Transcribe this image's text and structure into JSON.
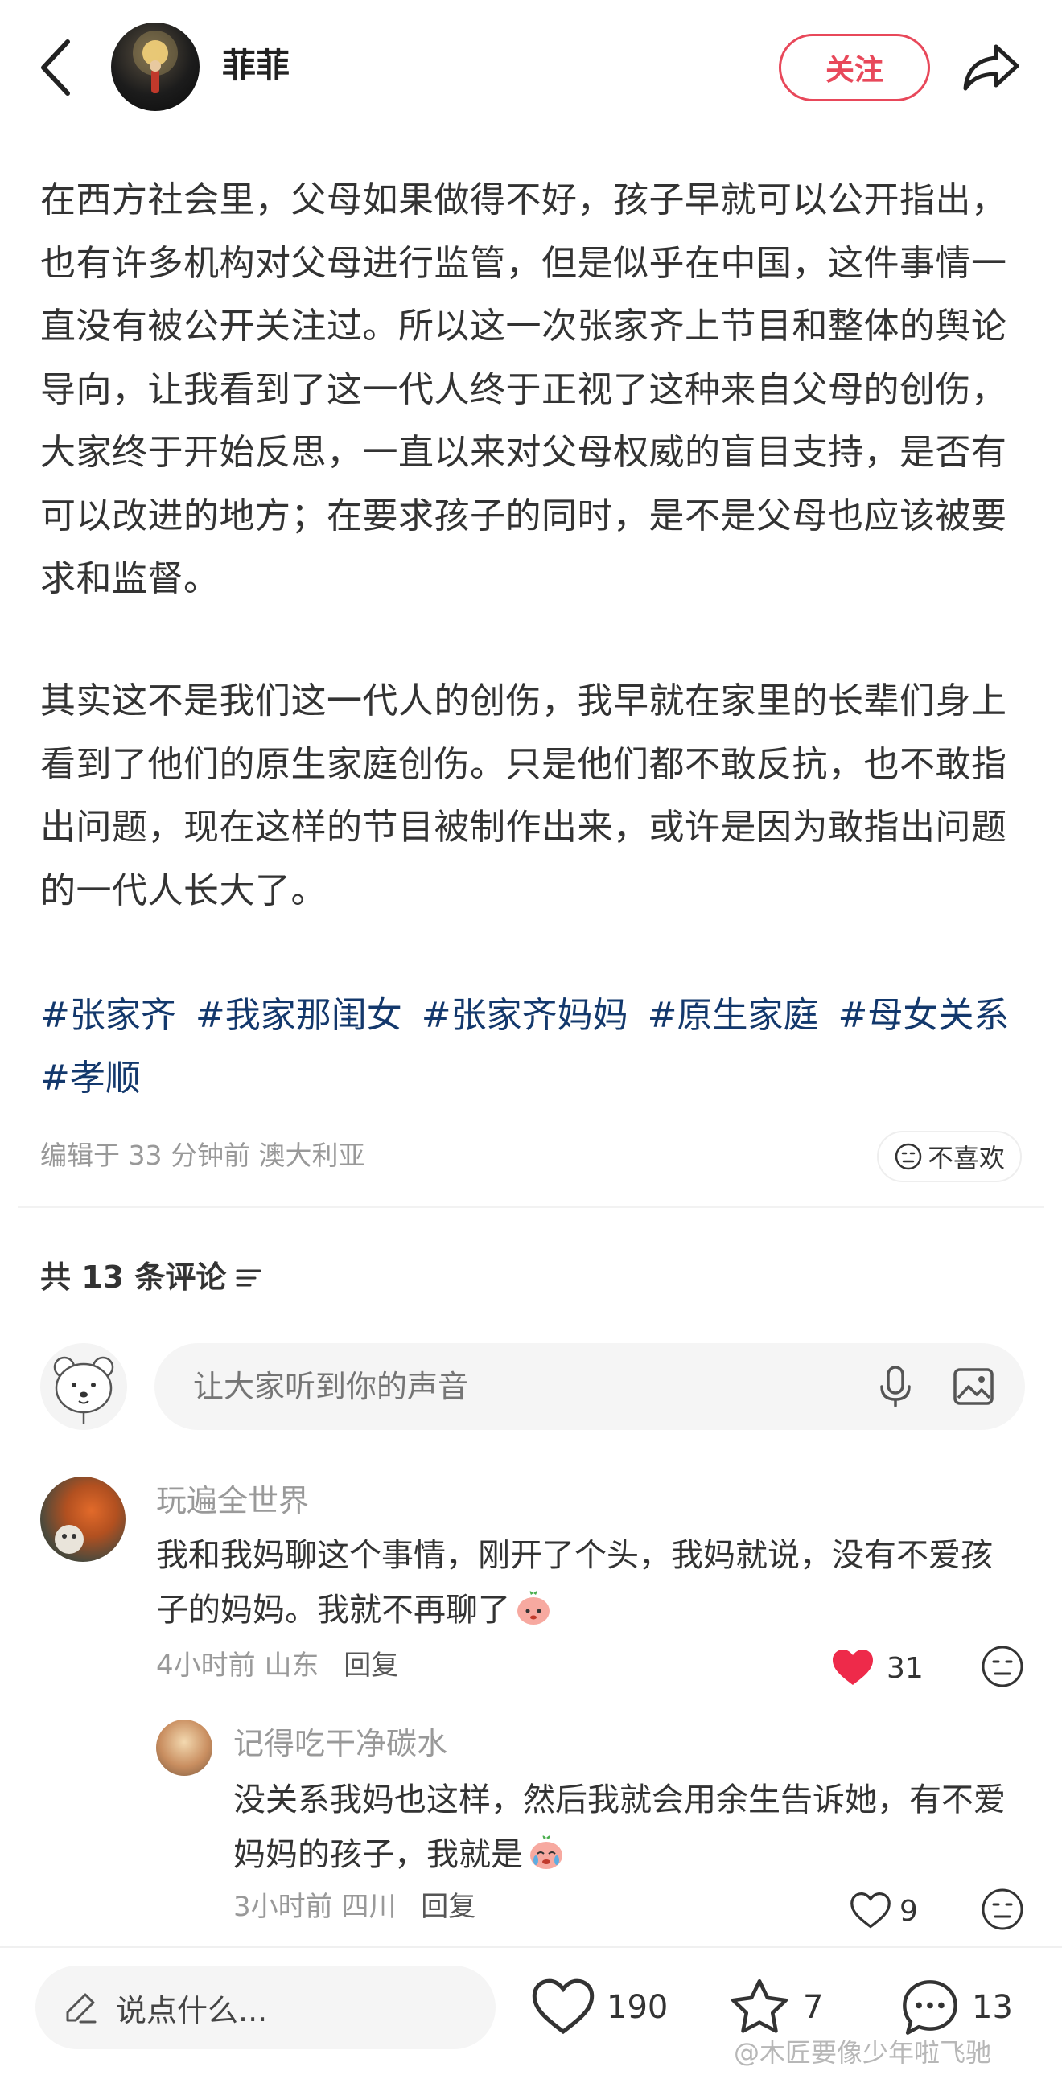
{
  "header": {
    "author_name": "菲菲",
    "follow_label": "关注"
  },
  "post": {
    "paragraph1": "在西方社会里，父母如果做得不好，孩子早就可以公开指出，也有许多机构对父母进行监管，但是似乎在中国，这件事情一直没有被公开关注过。所以这一次张家齐上节目和整体的舆论导向，让我看到了这一代人终于正视了这种来自父母的创伤，大家终于开始反思，一直以来对父母权威的盲目支持，是否有可以改进的地方；在要求孩子的同时，是不是父母也应该被要求和监督。",
    "paragraph2": "其实这不是我们这一代人的创伤，我早就在家里的长辈们身上看到了他们的原生家庭创伤。只是他们都不敢反抗，也不敢指出问题，现在这样的节目被制作出来，或许是因为敢指出问题的一代人长大了。",
    "tags": [
      "#张家齐",
      "#我家那闺女",
      "#张家齐妈妈",
      "#原生家庭",
      "#母女关系",
      "#孝顺"
    ],
    "edit_info": "编辑于 33 分钟前 澳大利亚",
    "dislike_label": "不喜欢"
  },
  "comments_section": {
    "count_label": "共 13 条评论",
    "input_placeholder": "让大家听到你的声音"
  },
  "comments": [
    {
      "user": "玩遍全世界",
      "text": "我和我妈聊这个事情，刚开了个头，我妈就说，没有不爱孩子的妈妈。我就不再聊了",
      "time": "4小时前",
      "location": "山东",
      "reply_label": "回复",
      "likes": "31",
      "liked": true
    },
    {
      "user": "记得吃干净碳水",
      "text": "没关系我妈也这样，然后我就会用余生告诉她，有不爱妈妈的孩子，我就是",
      "time": "3小时前",
      "location": "四川",
      "reply_label": "回复",
      "likes": "9",
      "liked": false
    }
  ],
  "bottom_bar": {
    "say_placeholder": "说点什么...",
    "like_count": "190",
    "favorite_count": "7",
    "comment_count": "13"
  },
  "watermark": "@木匠要像少年啦飞驰",
  "colors": {
    "accent": "#e8485a",
    "tag_blue": "#13386c",
    "like_red": "#ee2a4a"
  }
}
